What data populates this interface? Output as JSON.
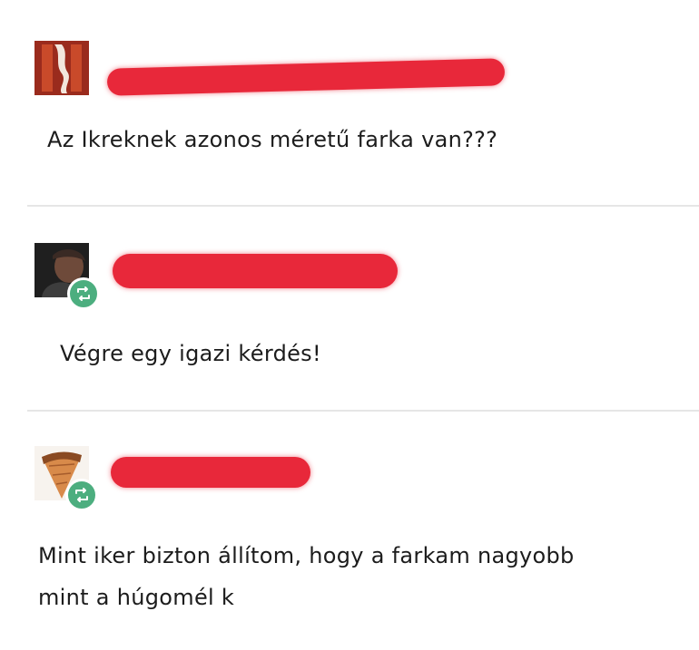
{
  "posts": [
    {
      "text_lines": [
        "Az Ikreknek azonos méretű farka van???"
      ],
      "has_repost_badge": false,
      "username_redacted": true
    },
    {
      "text_lines": [
        "Végre egy igazi kérdés!"
      ],
      "has_repost_badge": true,
      "username_redacted": true
    },
    {
      "text_lines": [
        "Mint iker bizton állítom, hogy a farkam nagyobb",
        "mint a húgomél k"
      ],
      "has_repost_badge": true,
      "username_redacted": true
    }
  ],
  "colors": {
    "redaction": "#e8283a",
    "repost_badge": "#4cae7f",
    "divider": "#e6e6e6"
  },
  "icons": {
    "avatar_1": "red-flag-avatar-icon",
    "avatar_2": "profile-photo-avatar",
    "avatar_3": "ice-cream-cone-avatar-icon",
    "badge": "repost-icon"
  }
}
